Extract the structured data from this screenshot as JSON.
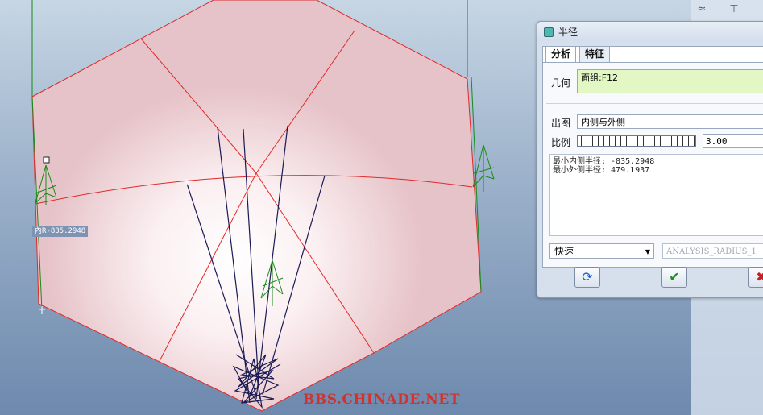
{
  "viewport": {
    "dimension_label": "內R-835.2948",
    "watermark": "BBS.CHINADE.NET"
  },
  "right_strip": {
    "icons": [
      "curve-analysis-icon",
      "datum-icon"
    ]
  },
  "dialog": {
    "title": "半径",
    "tabs": [
      {
        "label": "分析",
        "active": true
      },
      {
        "label": "特征",
        "active": false
      }
    ],
    "geometry_label": "几何",
    "geometry_value": "面组:F12",
    "plot_label": "出图",
    "plot_value": "内侧与外侧",
    "scale_label": "比例",
    "scale_value": "3.00",
    "results": [
      "最小内侧半径: -835.2948",
      "最小外侧半径: 479.1937"
    ],
    "mode_value": "快速",
    "name_value": "ANALYSIS_RADIUS_1",
    "buttons": {
      "refresh": "⟳",
      "ok": "✔",
      "cancel": "✖"
    }
  },
  "colors": {
    "surface_fill": "#e8c4c9",
    "surface_edges": "#e02a2a",
    "datum_lines": "#1a8a1a",
    "curvature_lines": "#1a1a55",
    "geometry_box": "#e3f7c5"
  }
}
